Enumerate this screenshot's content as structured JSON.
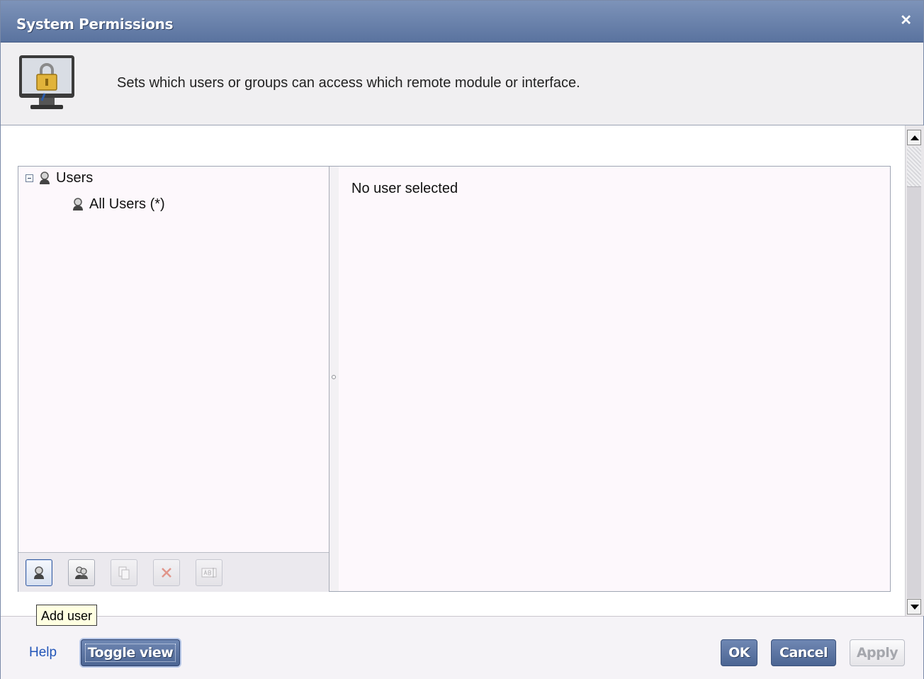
{
  "window": {
    "title": "System Permissions",
    "close_glyph": "✕"
  },
  "header": {
    "description": "Sets which users or groups can access which remote module or interface.",
    "icon": "locked-monitor-icon"
  },
  "tree": {
    "root": {
      "label": "Users",
      "icon": "user-icon",
      "expanded": true
    },
    "children": [
      {
        "label": "All Users (*)",
        "icon": "user-icon"
      }
    ]
  },
  "toolbar": {
    "buttons": [
      {
        "name": "add-user",
        "icon": "add-user-icon",
        "enabled": true,
        "active": true
      },
      {
        "name": "add-group",
        "icon": "add-group-icon",
        "enabled": true
      },
      {
        "name": "copy",
        "icon": "copy-icon",
        "enabled": false
      },
      {
        "name": "delete",
        "icon": "delete-icon",
        "enabled": false
      },
      {
        "name": "rename",
        "icon": "rename-icon",
        "enabled": false
      }
    ]
  },
  "tooltip": {
    "text": "Add user"
  },
  "details": {
    "message": "No user selected"
  },
  "footer": {
    "help_label": "Help",
    "toggle_label": "Toggle view",
    "ok_label": "OK",
    "cancel_label": "Cancel",
    "apply_label": "Apply"
  },
  "colors": {
    "titlebar": "#5a739f",
    "button_primary": "#4c6593",
    "link": "#2255b8",
    "pane_background": "#fdf8fc"
  }
}
